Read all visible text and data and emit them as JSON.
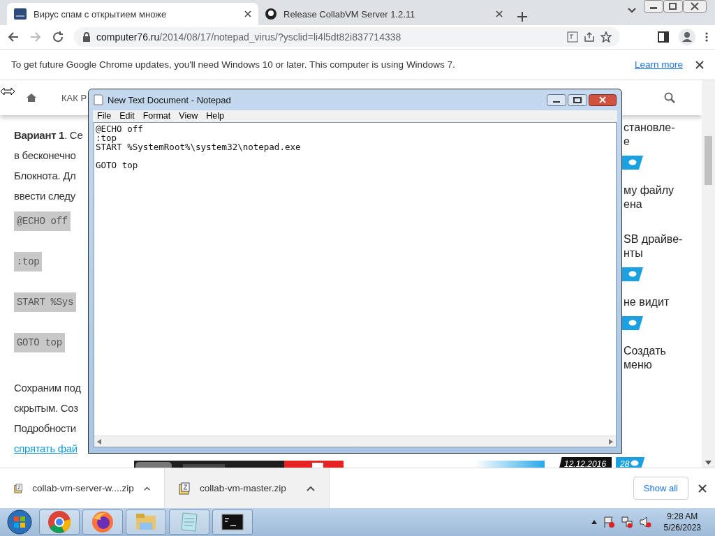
{
  "browser": {
    "tabs": [
      {
        "title": "Вирус спам с открытием множе",
        "kind": "site",
        "selected": true
      },
      {
        "title": "Release CollabVM Server 1.2.11 ",
        "kind": "github",
        "selected": false
      }
    ],
    "address": {
      "domain": "computer76.ru",
      "path": "/2014/08/17/notepad_virus/?ysclid=li4l5dt82i837714338"
    },
    "infobar": {
      "message": "To get future Google Chrome updates, you'll need Windows 10 or later. This computer is using Windows 7.",
      "link": "Learn more"
    }
  },
  "page": {
    "nav": {
      "item": "КАК Р"
    },
    "article": [
      {
        "kind": "text",
        "lines": [
          "**Вариант 1**. Се",
          "в бесконечно",
          "Блокнота. Дл",
          "ввести следу"
        ]
      },
      {
        "kind": "code",
        "lines": [
          "@ECHO off",
          ":top",
          "START %Sys",
          "GOTO top"
        ]
      },
      {
        "kind": "text",
        "lines": [
          "Сохраним под",
          "скрытым. Соз",
          "Подробности"
        ]
      },
      {
        "kind": "link",
        "lines": [
          "спрятать фай"
        ]
      }
    ],
    "sidebar": [
      {
        "kind": "text",
        "lines": [
          "становле-",
          "е"
        ]
      },
      {
        "kind": "badge"
      },
      {
        "kind": "text",
        "lines": [
          "му файлу",
          "ена"
        ]
      },
      {
        "kind": "text",
        "lines": [
          "SB драйве-",
          "нты"
        ]
      },
      {
        "kind": "badge"
      },
      {
        "kind": "text",
        "lines": [
          "не видит"
        ]
      },
      {
        "kind": "badge"
      },
      {
        "kind": "text",
        "lines": [
          "Создать",
          "меню"
        ]
      }
    ],
    "footer": {
      "date": "12.12.2016",
      "comments": "28"
    }
  },
  "notepad": {
    "title": "New Text Document - Notepad",
    "menu": [
      "File",
      "Edit",
      "Format",
      "View",
      "Help"
    ],
    "text": "@ECHO off\n:top\nSTART %SystemRoot%\\system32\\notepad.exe\n\nGOTO top"
  },
  "downloads": {
    "items": [
      {
        "name": "collab-vm-server-w....zip",
        "selected": false
      },
      {
        "name": "collab-vm-master.zip",
        "selected": true
      }
    ],
    "show_all": "Show all"
  },
  "taskbar": {
    "apps": [
      {
        "kind": "chrome"
      },
      {
        "kind": "firefox"
      },
      {
        "kind": "explorer"
      },
      {
        "kind": "notepad"
      },
      {
        "kind": "cmd"
      }
    ],
    "time": "9:28 AM",
    "date": "5/26/2023"
  }
}
